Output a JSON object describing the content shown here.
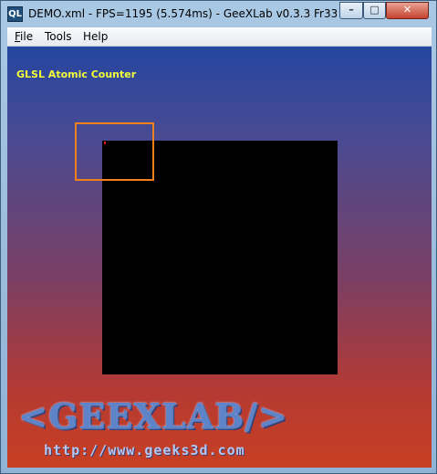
{
  "window": {
    "title": "DEMO.xml - FPS=1195 (5.574ms) - GeeXLab v0.3.3 Fr33 Editio...",
    "app_icon_text": "QL",
    "controls": {
      "minimize": "–",
      "maximize": "□",
      "close": "✕"
    }
  },
  "menubar": {
    "items": [
      {
        "label": "File",
        "accelerator": "F"
      },
      {
        "label": "Tools"
      },
      {
        "label": "Help"
      }
    ]
  },
  "viewport": {
    "demo_title": "GLSL Atomic Counter",
    "logo_text": "<GEEXLAB/>",
    "logo_url": "http://www.geeks3d.com",
    "colors": {
      "gradient_top": "#2546a0",
      "gradient_bottom": "#c83f22",
      "title_color": "#f4ff3a",
      "highlight_border": "#f0811c",
      "marker_color": "#e01818",
      "render_background": "#000000"
    }
  }
}
